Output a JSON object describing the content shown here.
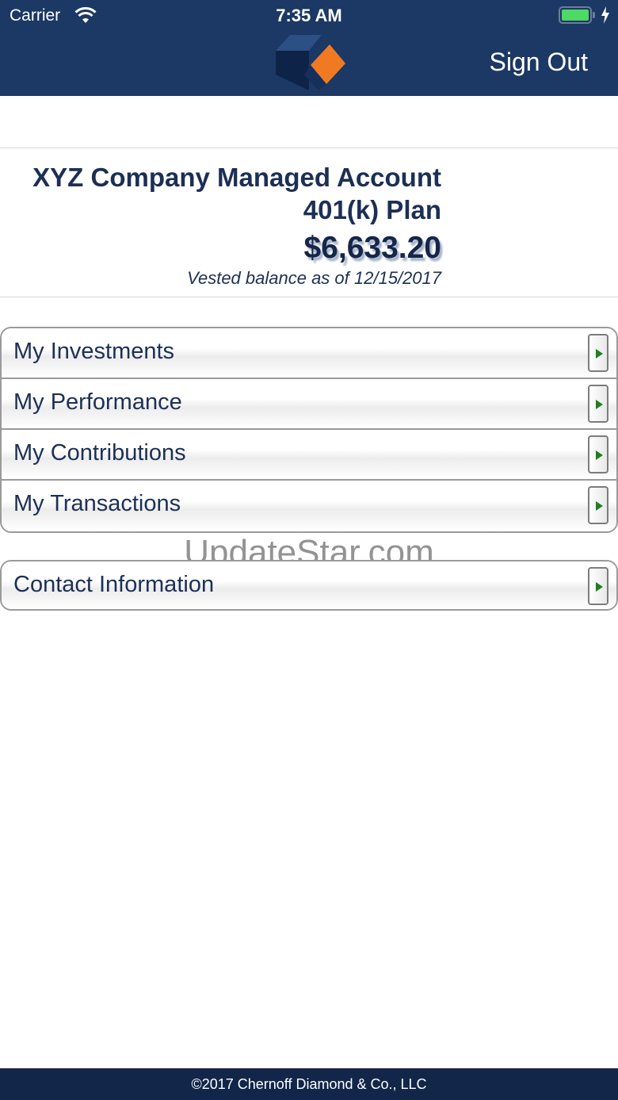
{
  "status_bar": {
    "carrier": "Carrier",
    "time": "7:35 AM",
    "wifi_icon": "wifi-icon",
    "battery_icon": "battery-full-icon",
    "charging_icon": "lightning-icon"
  },
  "navbar": {
    "logo_icon": "cube-logo",
    "sign_out_label": "Sign Out",
    "background_color": "#1c3864"
  },
  "plan": {
    "name_line1": "XYZ Company Managed Account",
    "name_line2": "401(k) Plan",
    "balance": "$6,633.20",
    "caption": "Vested balance as of 12/15/2017"
  },
  "menu": {
    "items": [
      {
        "label": "My Investments"
      },
      {
        "label": "My Performance"
      },
      {
        "label": "My Contributions"
      },
      {
        "label": "My Transactions"
      }
    ],
    "contact": {
      "label": "Contact Information"
    }
  },
  "watermark": "UpdateStar.com",
  "footer": {
    "copyright": "©2017 Chernoff Diamond & Co., LLC",
    "background_color": "#12264a"
  }
}
